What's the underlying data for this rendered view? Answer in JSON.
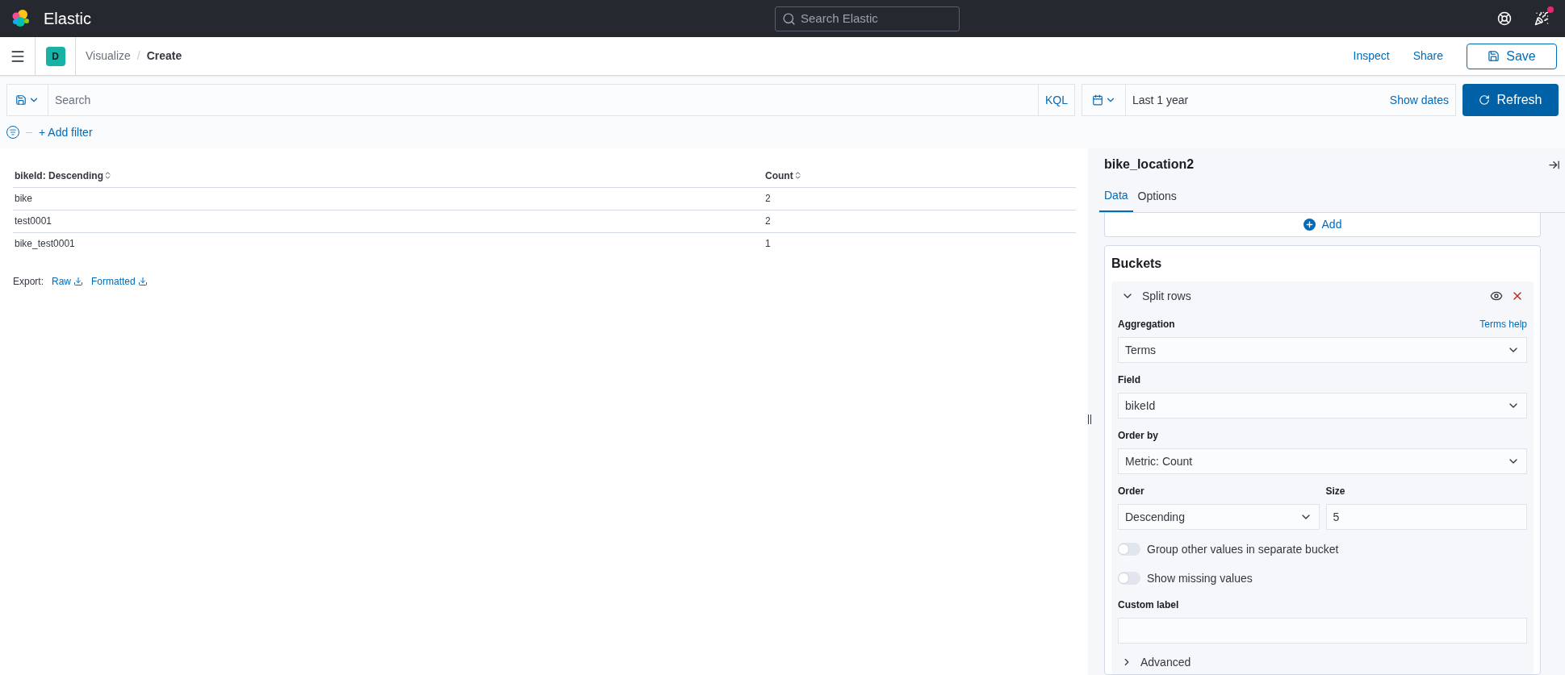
{
  "header": {
    "brand": "Elastic",
    "search_placeholder": "Search Elastic",
    "notification": true
  },
  "nav": {
    "space": "D",
    "breadcrumbs": [
      "Visualize",
      "Create"
    ],
    "separator": "/",
    "actions": [
      "Inspect",
      "Share"
    ],
    "save": "Save"
  },
  "query": {
    "placeholder": "Search",
    "language": "KQL",
    "time": "Last 1 year",
    "show_dates": "Show dates",
    "refresh": "Refresh",
    "add_filter": "+ Add filter"
  },
  "table": {
    "columns": [
      "bikeId: Descending",
      "Count"
    ],
    "rows": [
      [
        "bike",
        "2"
      ],
      [
        "test0001",
        "2"
      ],
      [
        "bike_test0001",
        "1"
      ]
    ]
  },
  "export": {
    "label": "Export:",
    "links": [
      "Raw",
      "Formatted"
    ]
  },
  "panel": {
    "title": "bike_location2",
    "tabs": [
      {
        "label": "Data",
        "selected": true
      },
      {
        "label": "Options",
        "selected": false
      }
    ],
    "add": "Add",
    "buckets_title": "Buckets",
    "agg": {
      "title": "Split rows",
      "expanded": true,
      "items": [
        {
          "kind": "select",
          "label": "Aggregation",
          "help": "Terms help",
          "value": "Terms"
        },
        {
          "kind": "select",
          "label": "Field",
          "value": "bikeId"
        },
        {
          "kind": "select",
          "label": "Order by",
          "value": "Metric: Count"
        },
        {
          "kind": "pair",
          "items": [
            {
              "kind": "select",
              "label": "Order",
              "value": "Descending"
            },
            {
              "kind": "input",
              "label": "Size",
              "value": "5"
            }
          ]
        },
        {
          "kind": "toggle",
          "label": "Group other values in separate bucket",
          "on": false
        },
        {
          "kind": "toggle",
          "label": "Show missing values",
          "on": false
        },
        {
          "kind": "input",
          "label": "Custom label"
        }
      ],
      "advanced": {
        "label": "Advanced",
        "expanded": false
      }
    }
  }
}
